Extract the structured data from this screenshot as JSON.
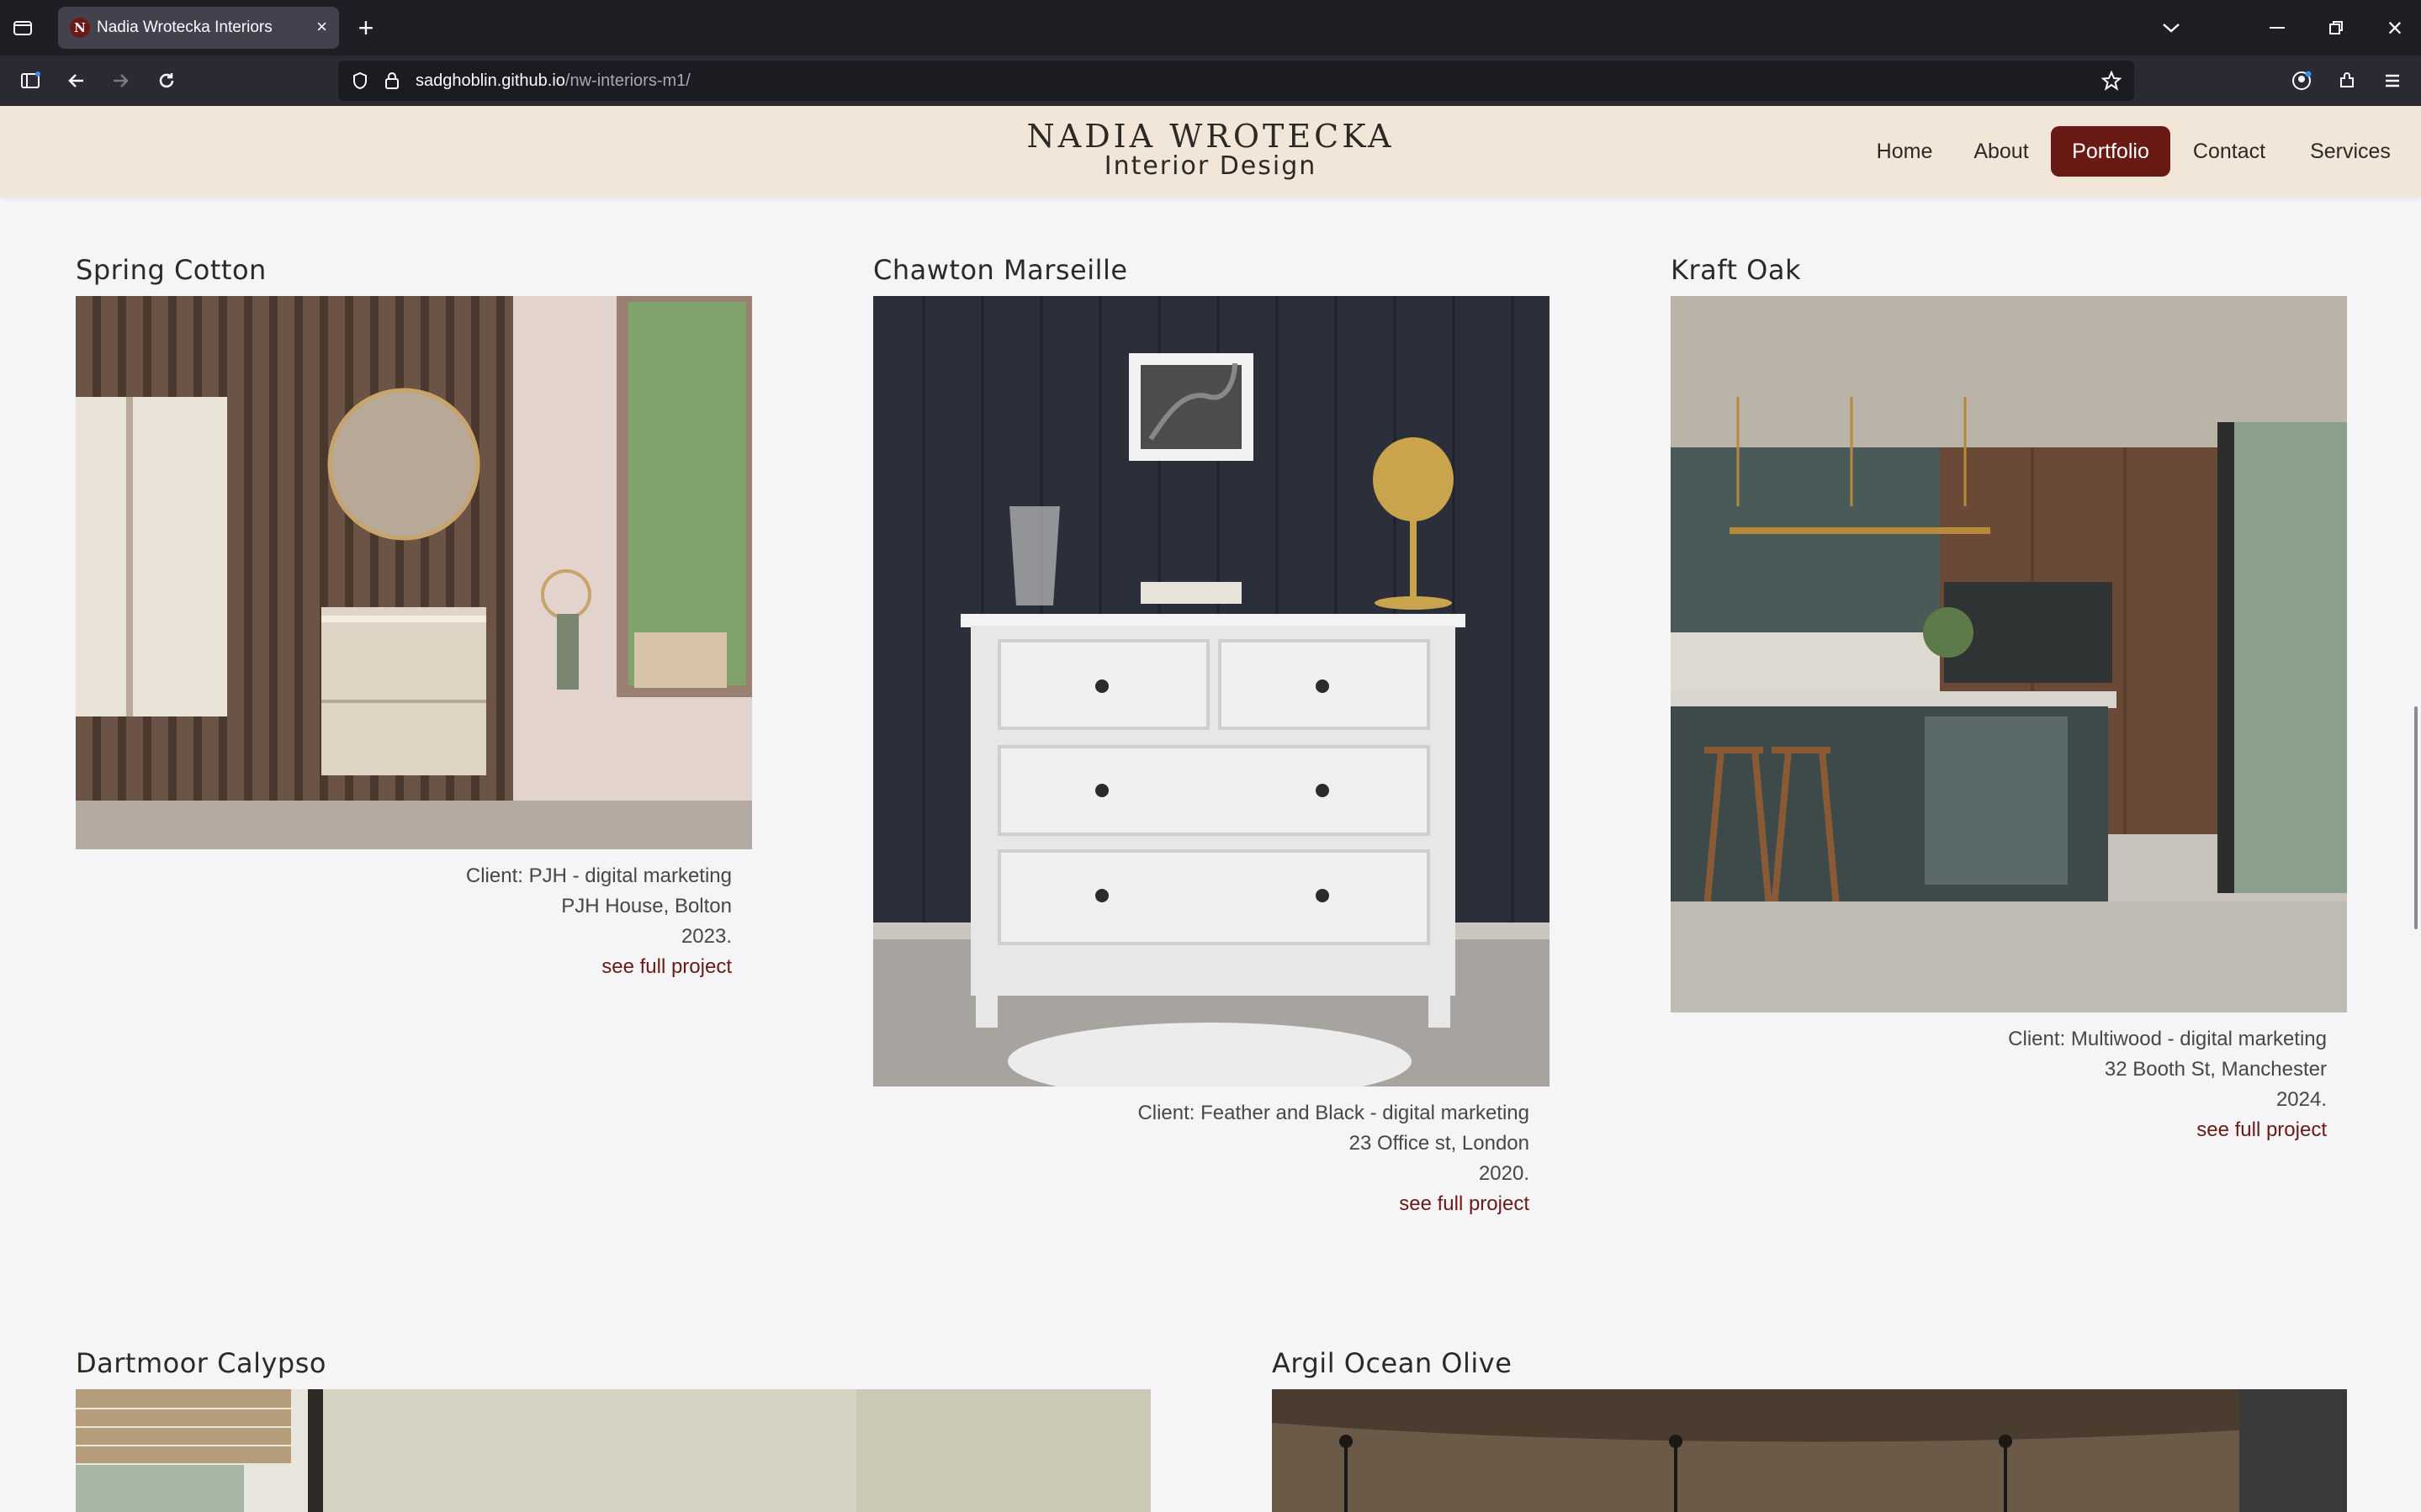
{
  "browser": {
    "tab_title": "Nadia Wrotecka Interiors",
    "favicon_letter": "N",
    "url_domain": "sadghoblin.github.io",
    "url_path": "/nw-interiors-m1/"
  },
  "site": {
    "brand_name": "NADIA WROTECKA",
    "brand_sub": "Interior Design",
    "nav": [
      {
        "label": "Home"
      },
      {
        "label": "About"
      },
      {
        "label": "Portfolio",
        "active": true
      },
      {
        "label": "Contact"
      },
      {
        "label": "Services"
      }
    ],
    "accent_color": "#6a1a14"
  },
  "projects": [
    {
      "title": "Spring Cotton",
      "client": "Client: PJH - digital marketing",
      "address": "PJH House, Bolton",
      "year": "2023.",
      "link": "see full project"
    },
    {
      "title": "Chawton Marseille",
      "client": "Client: Feather and Black - digital marketing",
      "address": "23 Office st, London",
      "year": "2020.",
      "link": "see full project"
    },
    {
      "title": "Kraft Oak",
      "client": "Client: Multiwood - digital marketing",
      "address": "32 Booth St, Manchester",
      "year": "2024.",
      "link": "see full project"
    },
    {
      "title": "Dartmoor Calypso"
    },
    {
      "title": "Argil Ocean Olive"
    }
  ]
}
